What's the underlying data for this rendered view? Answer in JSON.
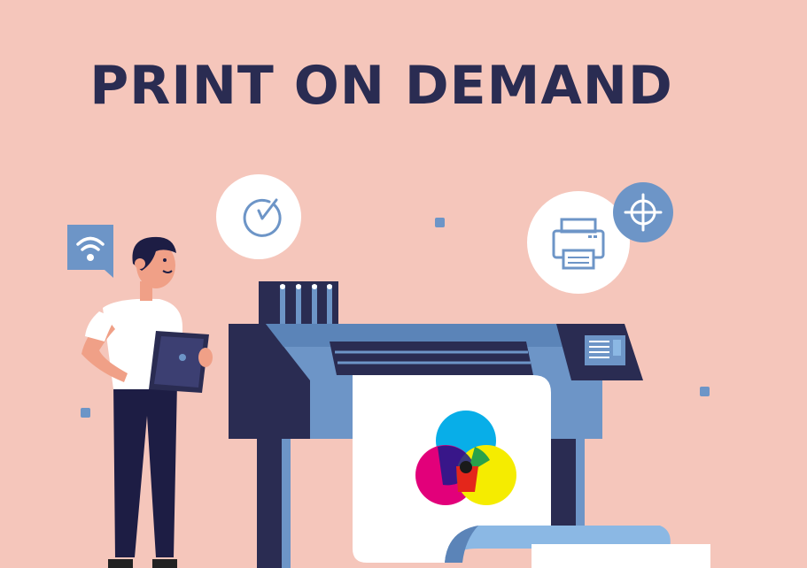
{
  "heading": {
    "text": "PRINT ON DEMAND"
  },
  "colors": {
    "background": "#f5c6bb",
    "navy": "#2a2c52",
    "blue": "#6d95c7",
    "light_blue": "#8bb8e4",
    "white": "#ffffff",
    "cyan": "#08aee8",
    "magenta": "#e2007a",
    "yellow": "#f5ec00"
  },
  "icons": [
    "wifi-icon",
    "clock-check-icon",
    "printer-icon",
    "target-icon"
  ]
}
